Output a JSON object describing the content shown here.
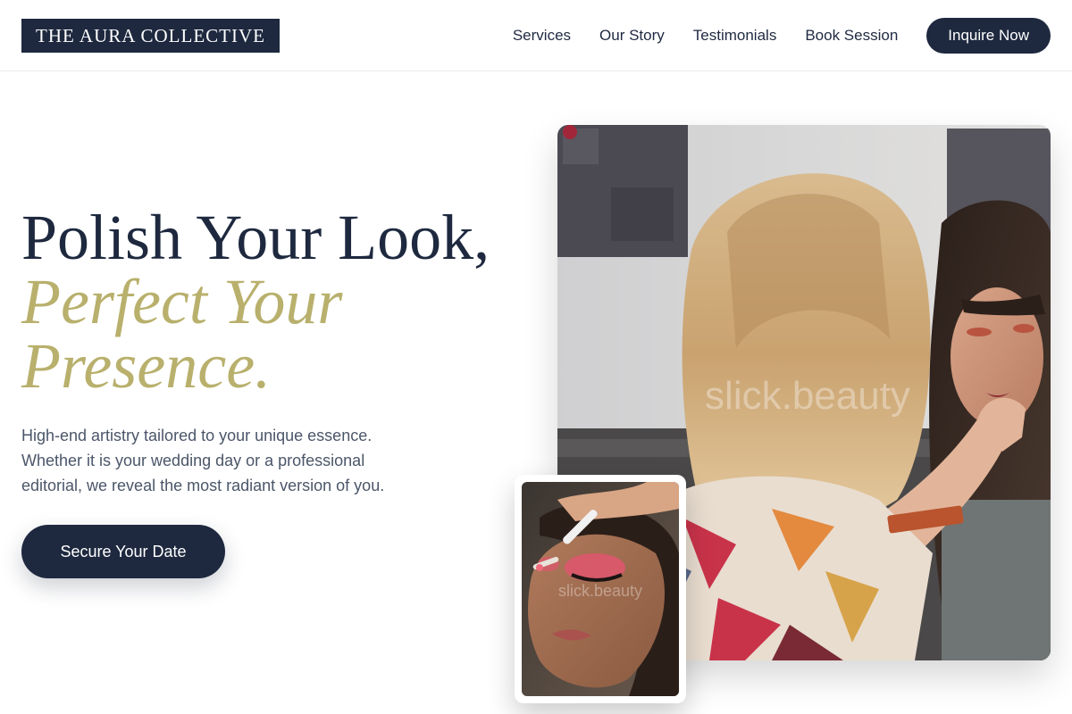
{
  "brand": {
    "name": "THE AURA COLLECTIVE"
  },
  "nav": {
    "items": [
      {
        "label": "Services"
      },
      {
        "label": "Our Story"
      },
      {
        "label": "Testimonials"
      },
      {
        "label": "Book Session"
      }
    ],
    "cta_label": "Inquire Now"
  },
  "hero": {
    "headline_line1": "Polish Your Look,",
    "headline_line2": "Perfect Your",
    "headline_line3": "Presence.",
    "subtext": "High-end artistry tailored to your unique essence. Whether it is your wedding day or a professional editorial, we reveal the most radiant version of you.",
    "cta_label": "Secure Your Date"
  },
  "images": {
    "main_watermark": "slick.beauty",
    "small_watermark": "slick.beauty"
  },
  "colors": {
    "navy": "#1e293f",
    "gold_accent": "#b8b06c",
    "body_text": "#4b5669"
  }
}
